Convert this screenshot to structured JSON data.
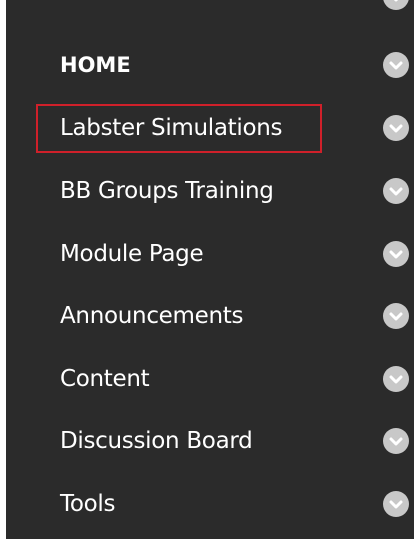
{
  "colors": {
    "sidebar_bg": "#2b2b2b",
    "text": "#ffffff",
    "chevron": "#c8c8c8",
    "highlight": "#d0202a"
  },
  "menu": {
    "items": [
      {
        "label": "HOME",
        "icon": "chevron-down-icon"
      },
      {
        "label": "Labster Simulations",
        "icon": "chevron-down-icon",
        "highlighted": true
      },
      {
        "label": "BB Groups Training",
        "icon": "chevron-down-icon"
      },
      {
        "label": "Module Page",
        "icon": "chevron-down-icon"
      },
      {
        "label": "Announcements",
        "icon": "chevron-down-icon"
      },
      {
        "label": "Content",
        "icon": "chevron-down-icon"
      },
      {
        "label": "Discussion Board",
        "icon": "chevron-down-icon"
      },
      {
        "label": "Tools",
        "icon": "chevron-down-icon"
      }
    ]
  }
}
